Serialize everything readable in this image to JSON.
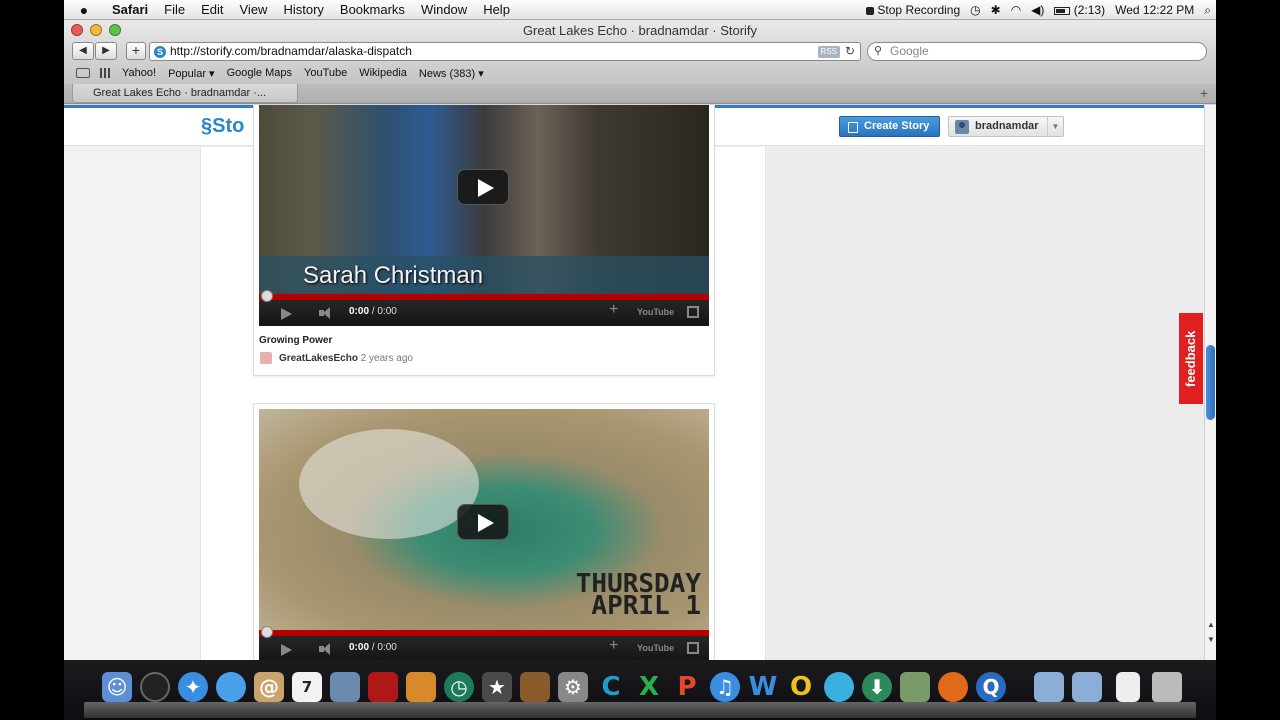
{
  "menubar": {
    "apple": "",
    "app": "Safari",
    "items": [
      "File",
      "Edit",
      "View",
      "History",
      "Bookmarks",
      "Window",
      "Help"
    ],
    "stop_recording": "Stop Recording",
    "battery": "(2:13)",
    "clock": "Wed 12:22 PM"
  },
  "window": {
    "title": "Great Lakes Echo · bradnamdar · Storify"
  },
  "toolbar": {
    "back": "◀",
    "forward": "▶",
    "add": "+",
    "url": "http://storify.com/bradnamdar/alaska-dispatch",
    "rss": "RSS",
    "search_placeholder": "Google"
  },
  "bookmarks": [
    "Yahoo!",
    "Popular ▾",
    "Google Maps",
    "YouTube",
    "Wikipedia",
    "News (383) ▾"
  ],
  "tabs": [
    {
      "label": "Great Lakes Echo · bradnamdar ·..."
    }
  ],
  "header": {
    "logo": "Sto",
    "create_story": "Create Story",
    "username": "bradnamdar"
  },
  "cards": [
    {
      "caption": "Sarah Christman",
      "time": "0:00",
      "duration": " / 0:00",
      "youtube": "YouTube",
      "title": "Growing Power",
      "source": "GreatLakesEcho",
      "ago": "2 years ago"
    },
    {
      "overlay_line1": "THURSDAY",
      "overlay_line2": "APRIL 1",
      "time": "0:00",
      "duration": " / 0:00",
      "youtube": "YouTube"
    }
  ],
  "feedback": "feedback",
  "colors": {
    "accent": "#2a86c8",
    "create_button": "#2a72c0",
    "feedback": "#e0201f",
    "progress": "#b40000"
  },
  "dock": {
    "icons": [
      "finder-icon",
      "dashboard-icon",
      "safari-icon",
      "ichat-icon",
      "address-book-icon",
      "ical-icon",
      "iphoto-icon",
      "photo-booth-icon",
      "preview-icon",
      "time-machine-icon",
      "imovie-icon",
      "garageband-icon",
      "system-preferences-icon",
      "c-app-icon",
      "excel-icon",
      "powerpoint-icon",
      "itunes-icon",
      "word-icon",
      "outlook-icon",
      "messenger-icon",
      "download-icon",
      "remote-desktop-icon",
      "firefox-icon",
      "quicktime-icon",
      "applications-folder-icon",
      "documents-folder-icon",
      "text-document-icon",
      "trash-icon"
    ],
    "ical_day": "7",
    "letters": {
      "c": "C",
      "excel": "X",
      "powerpoint": "P",
      "word": "W",
      "outlook": "O"
    }
  }
}
